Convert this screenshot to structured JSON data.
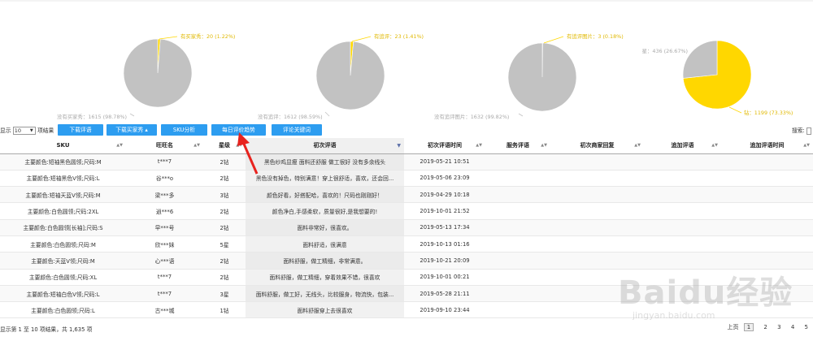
{
  "pies": [
    {
      "slices": [
        {
          "label": "有买家秀：20 (1.22%)",
          "value": 1.22,
          "color": "#ffd700"
        },
        {
          "label": "没有买家秀：1615 (98.78%)",
          "value": 98.78,
          "color": "#c2c2c2"
        }
      ]
    },
    {
      "slices": [
        {
          "label": "有追评：23 (1.41%)",
          "value": 1.41,
          "color": "#ffd700"
        },
        {
          "label": "没有追评：1612 (98.59%)",
          "value": 98.59,
          "color": "#c2c2c2"
        }
      ]
    },
    {
      "slices": [
        {
          "label": "有追评图片：3 (0.18%)",
          "value": 0.18,
          "color": "#ffd700"
        },
        {
          "label": "没有追评图片：1632 (99.82%)",
          "value": 99.82,
          "color": "#c2c2c2"
        }
      ]
    },
    {
      "slices": [
        {
          "label": "钻：1199 (73.33%)",
          "value": 73.33,
          "color": "#ffd700"
        },
        {
          "label": "星：436 (26.67%)",
          "value": 26.67,
          "color": "#c2c2c2"
        }
      ]
    }
  ],
  "controls": {
    "show_prefix": "显示",
    "page_size": "10",
    "show_suffix": "项结果",
    "buttons": [
      "下载评语",
      "下载买家秀 ▴",
      "SKU分析",
      "每日评价趋势",
      "评论关键词"
    ],
    "search_label": "搜索:"
  },
  "table": {
    "headers": [
      "SKU",
      "旺旺名",
      "星级",
      "初次评语",
      "初次评语时间",
      "服务评语",
      "初次商家回复",
      "追加评语",
      "追加评语时间"
    ],
    "rows": [
      [
        "主要颜色:短袖黑色圆领;尺码:M",
        "t***7",
        "2钻",
        "黑色纱鸡显瘦 面料还舒服 做工很好 没有多余线头",
        "2019-05-21 10:51",
        "",
        "",
        "",
        ""
      ],
      [
        "主要颜色:短袖黑色V领;尺码:L",
        "谷***o",
        "2钻",
        "黑色没有掉色，特别满意！穿上很舒适，喜欢，还会回...",
        "2019-05-06 23:09",
        "",
        "",
        "",
        ""
      ],
      [
        "主要颜色:短袖天蓝V领;尺码:M",
        "梁***多",
        "3钻",
        "颜色好看，好搭配哈，喜欢的！尺码也刚刚好！",
        "2019-04-29 10:18",
        "",
        "",
        "",
        ""
      ],
      [
        "主要颜色:白色圆领;尺码:2XL",
        "逍***6",
        "2钻",
        "颜色净白,手感柔软，质量很好,是我想要的!",
        "2019-10-01 21:52",
        "",
        "",
        "",
        ""
      ],
      [
        "主要颜色:白色圆领[长袖];尺码:S",
        "早***号",
        "2钻",
        "面料非常好，很喜欢。",
        "2019-05-13 17:34",
        "",
        "",
        "",
        ""
      ],
      [
        "主要颜色:白色圆领;尺码:M",
        "欣***妹",
        "5星",
        "面料舒适，很满意",
        "2019-10-13 01:16",
        "",
        "",
        "",
        ""
      ],
      [
        "主要颜色:天蓝V领;尺码:M",
        "心***语",
        "2钻",
        "面料舒服，做工精细，非常满意。",
        "2019-10-21 20:09",
        "",
        "",
        "",
        ""
      ],
      [
        "主要颜色:白色圆领;尺码:XL",
        "t***7",
        "2钻",
        "面料舒服，做工精细，穿着效果不错，很喜欢",
        "2019-10-01 00:21",
        "",
        "",
        "",
        ""
      ],
      [
        "主要颜色:短袖白色V领;尺码:L",
        "t***7",
        "3星",
        "面料舒服，做工好，无线头，比较服身，物流快，包装...",
        "2019-05-28 21:11",
        "",
        "",
        "",
        ""
      ],
      [
        "主要颜色:白色圆领;尺码:L",
        "古***城",
        "1钻",
        "面料舒服穿上去很喜欢",
        "2019-09-10 23:44",
        "",
        "",
        "",
        ""
      ]
    ]
  },
  "footer": {
    "info": "显示第 1 至 10 项结果，共 1,635 项",
    "prev": "上页",
    "pages": [
      "1",
      "2",
      "3",
      "4",
      "5"
    ]
  },
  "watermark": {
    "big": "Baidu经验",
    "small": "jingyan.baidu.com"
  }
}
